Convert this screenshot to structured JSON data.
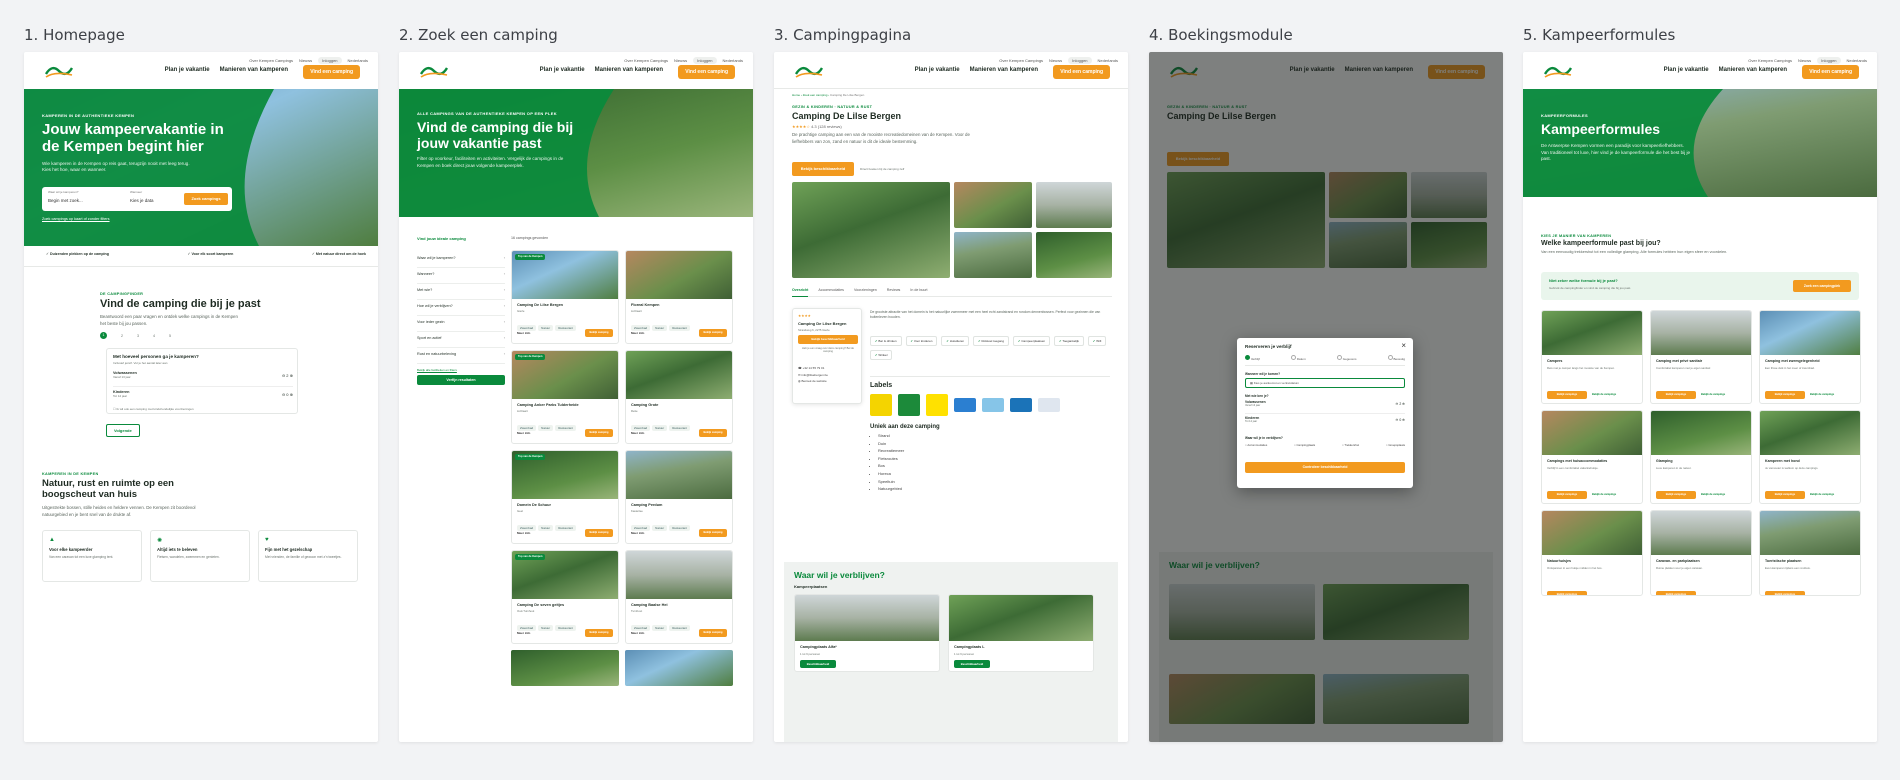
{
  "columns": [
    {
      "title": "1. Homepage"
    },
    {
      "title": "2. Zoek een camping"
    },
    {
      "title": "3. Campingpagina"
    },
    {
      "title": "4. Boekingsmodule"
    },
    {
      "title": "5. Kampeerformules"
    }
  ],
  "header": {
    "util_links": [
      "Over Kempen Campings",
      "Nieuws",
      "Inloggen",
      "Nederlands"
    ],
    "nav": [
      "Plan je vakantie",
      "Manieren van kamperen"
    ],
    "cta": "Vind een camping"
  },
  "home": {
    "eyebrow": "Kamperen in de authentieke Kempen",
    "title": "Jouw kampeervakantie in de Kempen begint hier",
    "intro": "Wie kamperen in de Kempen op reis gaat, terugzijn nooit met leeg terug. Kies het hoe, waar en wanneer.",
    "search_where_label": "Waar wil je kamperen?",
    "search_where_value": "Begin met zoek...",
    "search_when_label": "Wanneer",
    "search_when_value": "Kies je data",
    "search_button": "Zoek campings",
    "search_link": "Zoek campings op kaart of zonder filters",
    "usps": [
      "Duizenden plekken op de camping",
      "Voor elk soort kamperen",
      "Met natuur direct om de hoek"
    ],
    "finder_kicker": "De campingfinder",
    "finder_title": "Vind de camping die bij je past",
    "finder_text": "Beantwoord een paar vragen en ontdek welke campings in de Kempen het beste bij jou passen.",
    "steps": [
      "1",
      "2",
      "3",
      "4",
      "5"
    ],
    "question": "Met hoeveel personen ga je kamperen?",
    "question_sub": "Inclusief jezelf. Vul je het aantal later aan",
    "person_rows": [
      {
        "label": "Volwassenen",
        "sub": "Vanaf 13 jaar",
        "value": "2"
      },
      {
        "label": "Kinderen",
        "sub": "Tot 12 jaar",
        "value": "0"
      }
    ],
    "check_label": "Ik wil ook een camping met kindvriendelijke voorzieningen",
    "next_button": "Volgende",
    "nature_kicker": "Kamperen in de Kempen",
    "nature_title": "Natuur, rust en ruimte op een boogscheut van huis",
    "nature_text": "Uitgestrekte bossen, stille heides en heldere vennen. De Kempen zit boordevol natuurgebied en je bent snel van de drukte af.",
    "features": [
      {
        "title": "Voor elke kampeerder",
        "text": "Van een caravan tot een luxe glamping tent."
      },
      {
        "title": "Altijd iets te beleven",
        "text": "Fietsen, wandelen, zwemmen en genieten."
      },
      {
        "title": "Fijn met het gezelschap",
        "text": "Met vrienden, de familie of gewoon met z'n tweetjes."
      }
    ]
  },
  "search": {
    "eyebrow": "Alle campings van de authentieke Kempen op een plek",
    "title": "Vind de camping die bij jouw vakantie past",
    "intro": "Filter op voorkeur, faciliteiten en activiteiten. Vergelijk de campings in de Kempen en boek direct jouw volgende kampeerplek.",
    "filter_title": "Vind jouw ideale camping",
    "results_count": "16 campings gevonden",
    "filters": [
      "Waar wil je kamperen?",
      "Wanneer?",
      "Met wie?",
      "Hoe wil je verblijven?",
      "Voor ieder gezin",
      "Sport en actief",
      "Rust en natuurbeleving"
    ],
    "filter_link": "Bekijk alle faciliteiten en filters",
    "filter_button": "Verfijn resultaten",
    "badge": "Top van de Kempen",
    "camps": [
      {
        "name": "Camping De Lilse Bergen",
        "town": "Gierle"
      },
      {
        "name": "Floreal Kempen",
        "town": "Lichtaart"
      },
      {
        "name": "Camping Anker Parks Tulderheide",
        "town": "Lichtaart"
      },
      {
        "name": "Camping Grote",
        "town": "Retie"
      },
      {
        "name": "Domein De Schuur",
        "town": "Geel"
      },
      {
        "name": "Camping Perdum",
        "town": "Kasterlee"
      },
      {
        "name": "Camping De seven geitjes",
        "town": "Oud-Turnhout"
      },
      {
        "name": "Camping Baalse Hei",
        "town": "Turnhout"
      }
    ],
    "tags": [
      "Zwembad",
      "Natuur",
      "Restaurant"
    ],
    "more_info": "Meer info",
    "book": "Bekijk camping"
  },
  "camp": {
    "breadcrumb": [
      "Home",
      "Zoek een camping",
      "Camping De Lilse Bergen"
    ],
    "eyebrow": "Gezin & Kinderen · Natuur & rust",
    "title": "Camping De Lilse Bergen",
    "rating_text": "4.3 (128 reviews)",
    "intro": "De prachtige camping aan een van de mooiste recreatiedomeinen van de Kempen. Voor de liefhebbers van zon, zand en natuur is dit de ideale bestemming.",
    "book_button": "Bekijk beschikbaarheid",
    "book_note": "Direct boeken bij de camping zelf",
    "tabs": [
      "Overzicht",
      "Accommodaties",
      "Voorzieningen",
      "Reviews",
      "In de buurt"
    ],
    "card_name": "Camping De Lilse Bergen",
    "card_sub": "Strandweg 6, 2275 Gierle",
    "card_button": "Bekijk beschikbaarheid",
    "card_note": "Heb je een vraag over deze camping? Bel de camping",
    "contact": [
      "+32 14 55 79 01",
      "info@lilsebergen.be",
      "Bezoek de website"
    ],
    "desc": "De grootste attractie van het domein is het natuurlijke zwemmeer met een heel echt zandstrand en rondom dennenbossen. Perfect voor gezinnen die van buitenleven houden.",
    "facilities": [
      "Bar & drinken",
      "Voor kinderen",
      "Huisdieren",
      "Rolstoel toegang",
      "Campeerplaatsen",
      "Toegankelijk",
      "Wifi",
      "Winkel"
    ],
    "labels_title": "Labels",
    "unique_title": "Uniek aan deze camping",
    "unique": [
      "Strand",
      "Duin",
      "Recreatiemeer",
      "Fietsroutes",
      "Bos",
      "Horeca",
      "Speeltuin",
      "Natuurgebied"
    ],
    "stay_title": "Waar wil je verblijven?",
    "stay_sub": "Kampeerplaatsen",
    "stays": [
      {
        "name": "Campingplaats Alfa*",
        "sub": "1 tot 6 personen"
      },
      {
        "name": "Campingplaats L",
        "sub": "1 tot 6 personen"
      }
    ],
    "stay_button": "Beschikbaarheid"
  },
  "booking": {
    "modal_title": "Reserveren je verblijf",
    "steps": [
      "Verblijf",
      "Datum",
      "Gegevens",
      "Bevestig"
    ],
    "where_label": "Wanneer wil je komen?",
    "where_value": "Kies je aankomst en vertrekdatum",
    "who_label": "Met wie ben je?",
    "rows": [
      {
        "label": "Volwassenen",
        "sub": "Vanaf 13 jaar",
        "value": "2"
      },
      {
        "label": "Kinderen",
        "sub": "Tot 12 jaar",
        "value": "0"
      }
    ],
    "type_label": "Waar wil je in verblijven?",
    "types": [
      "Accommodaties",
      "Campingplaats",
      "Trekkershut",
      "Groepsplaats"
    ],
    "submit": "Controleer beschikbaarheid",
    "close": "×"
  },
  "formules": {
    "eyebrow": "Kampeerformules",
    "title": "Kampeerformules",
    "intro": "De Antwerpse Kempen vormen een paradijs voor kampeerliefhebbers. Van traditioneel tot luxe, hier vind je de kampeerformule die het best bij je past.",
    "kicker": "Kies je manier van kamperen",
    "heading": "Welke kampeerformule past bij jou?",
    "text": "Van een eenvoudig trekkershut tot een volledige glamping. Alle formules hebben hun eigen sfeer en voordelen.",
    "banner_title": "Niet zeker welke formule bij je past?",
    "banner_text": "Gebruik de campingfinder en vind de camping die bij jou past.",
    "banner_button": "Zoek een campingplek",
    "cards": [
      {
        "title": "Campers",
        "text": "Reis met je camper langs het mooiste van de Kempen."
      },
      {
        "title": "Camping met privé sanitair",
        "text": "Comfortabel kamperen met je eigen sanitair."
      },
      {
        "title": "Camping met zwemgelegenheid",
        "text": "Een frisse duik in het meer of zwembad."
      },
      {
        "title": "Campings met huisaccommodaties",
        "text": "Verblijf in een comfortabel vakantiehuisje."
      },
      {
        "title": "Glamping",
        "text": "Luxe kamperen in de natuur."
      },
      {
        "title": "Kamperen met hond",
        "text": "Je viervoeter is welkom op deze campings."
      },
      {
        "title": "Natuurhuisjes",
        "text": "Ontspannen in een huisje midden in het bos."
      },
      {
        "title": "Caravan- en parkplaatsen",
        "text": "Ruime plekken voor je eigen caravan."
      },
      {
        "title": "Toeristische plaatsen",
        "text": "Even kamperen tijdens een rondreis."
      }
    ],
    "btn_primary": "Bekijk campings",
    "btn_secondary": "Bekijk de campings"
  },
  "colors": {
    "brand_green": "#0a8a3c",
    "accent_orange": "#f29a1f",
    "page_bg": "#f2f3f5"
  }
}
